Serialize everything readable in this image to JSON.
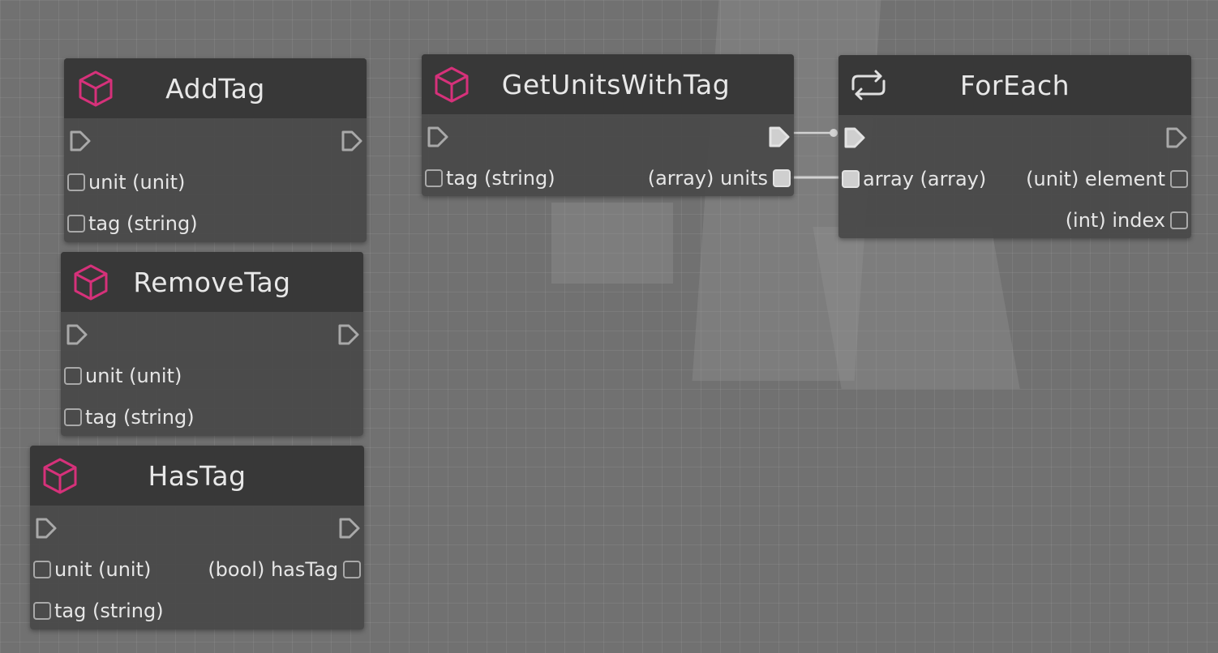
{
  "nodes": {
    "addtag": {
      "title": "AddTag",
      "icon": "cube-icon",
      "inputs": [
        "unit (unit)",
        "tag (string)"
      ]
    },
    "removetag": {
      "title": "RemoveTag",
      "icon": "cube-icon",
      "inputs": [
        "unit (unit)",
        "tag (string)"
      ]
    },
    "hastag": {
      "title": "HasTag",
      "icon": "cube-icon",
      "inputs": [
        "unit (unit)",
        "tag (string)"
      ],
      "outputs": [
        "(bool) hasTag"
      ]
    },
    "getunitswithtag": {
      "title": "GetUnitsWithTag",
      "icon": "cube-icon",
      "inputs": [
        "tag (string)"
      ],
      "outputs": [
        "(array) units"
      ]
    },
    "foreach": {
      "title": "ForEach",
      "icon": "loop-icon",
      "inputs": [
        "array (array)"
      ],
      "outputs": [
        "(unit) element",
        "(int) index"
      ]
    }
  },
  "colors": {
    "node_icon": "#d6317a",
    "node_body": "#484848",
    "node_header": "#383838",
    "pin_outline": "#a9a9a9",
    "pin_connected": "#cfcfcf",
    "wire": "#d2d2d2"
  }
}
